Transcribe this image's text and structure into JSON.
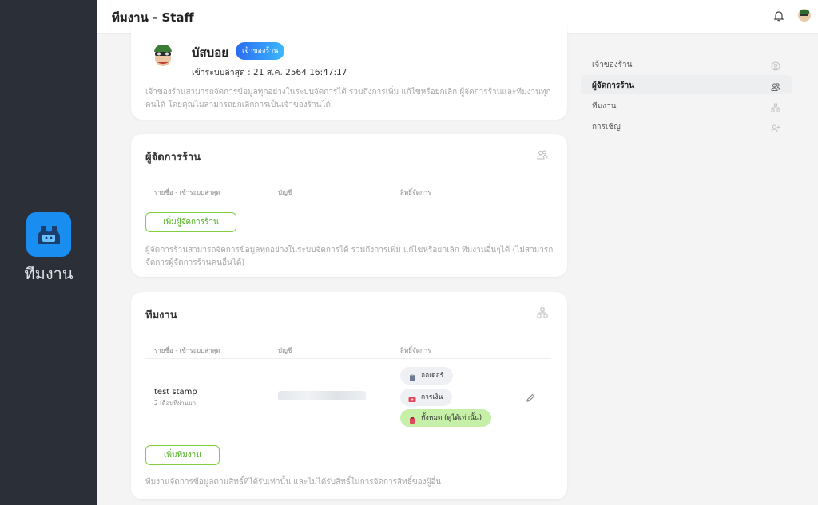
{
  "app": {
    "name": "ทีมงาน"
  },
  "header": {
    "title": "ทีมงาน - Staff",
    "icons": [
      "bell-icon",
      "avatar"
    ]
  },
  "owner": {
    "name": "บัสบอย",
    "badge": "เจ้าของร้าน",
    "last_login": "เข้าระบบล่าสุด : 21 ส.ค. 2564 16:47:17",
    "description": "เจ้าของร้านสามารถจัดการข้อมูลทุกอย่างในระบบจัดการได้ รวมถึงการเพิ่ม แก้ไขหรือยกเลิก ผู้จัดการร้านและทีมงานทุกคนได้ โดยคุณไม่สามารถยกเลิกการเป็นเจ้าของร้านได้"
  },
  "managers": {
    "title": "ผู้จัดการร้าน",
    "icon": "users-icon",
    "columns": [
      "รายชื่อ - เข้าระบบล่าสุด",
      "บัญชี",
      "สิทธิ์จัดการ"
    ],
    "add_button": "เพิ่มผู้จัดการร้าน",
    "description": "ผู้จัดการร้านสามารถจัดการข้อมูลทุกอย่างในระบบจัดการได้ รวมถึงการเพิ่ม แก้ไขหรือยกเลิก ทีมงานอื่นๆได้ (ไม่สามารถจัดการผู้จัดการร้านคนอื่นได้)"
  },
  "team": {
    "title": "ทีมงาน",
    "icon": "hierarchy-icon",
    "columns": [
      "รายชื่อ - เข้าระบบล่าสุด",
      "บัญชี",
      "สิทธิ์จัดการ"
    ],
    "members": [
      {
        "name": "test stamp",
        "last_login": "2 เดือนที่ผ่านมา",
        "permissions": [
          {
            "label": "ออเดอร์",
            "icon": "clipboard-icon",
            "color": "#6b7a90"
          },
          {
            "label": "การเงิน",
            "icon": "money-icon",
            "color": "#e0475b"
          },
          {
            "label": "ทั้งหมด (ดูได้เท่านั้น)",
            "icon": "all-icon",
            "color": "#e0475b"
          }
        ]
      }
    ],
    "add_button": "เพิ่มทีมงาน",
    "description": "ทีมงานจัดการข้อมูลตามสิทธิ์ที่ได้รับเท่านั้น และไม่ได้รับสิทธิ์ในการจัดการสิทธิ์ของผู้อื่น"
  },
  "side_nav": {
    "items": [
      {
        "label": "เจ้าของร้าน",
        "icon": "user-circle-icon",
        "active": false
      },
      {
        "label": "ผู้จัดการร้าน",
        "icon": "users-icon",
        "active": true
      },
      {
        "label": "ทีมงาน",
        "icon": "hierarchy-icon",
        "active": false
      },
      {
        "label": "การเชิญ",
        "icon": "user-plus-icon",
        "active": false
      }
    ]
  },
  "colors": {
    "rail": "#2b2f37",
    "accent": "#1a8ef0",
    "green": "#4caf1a"
  }
}
